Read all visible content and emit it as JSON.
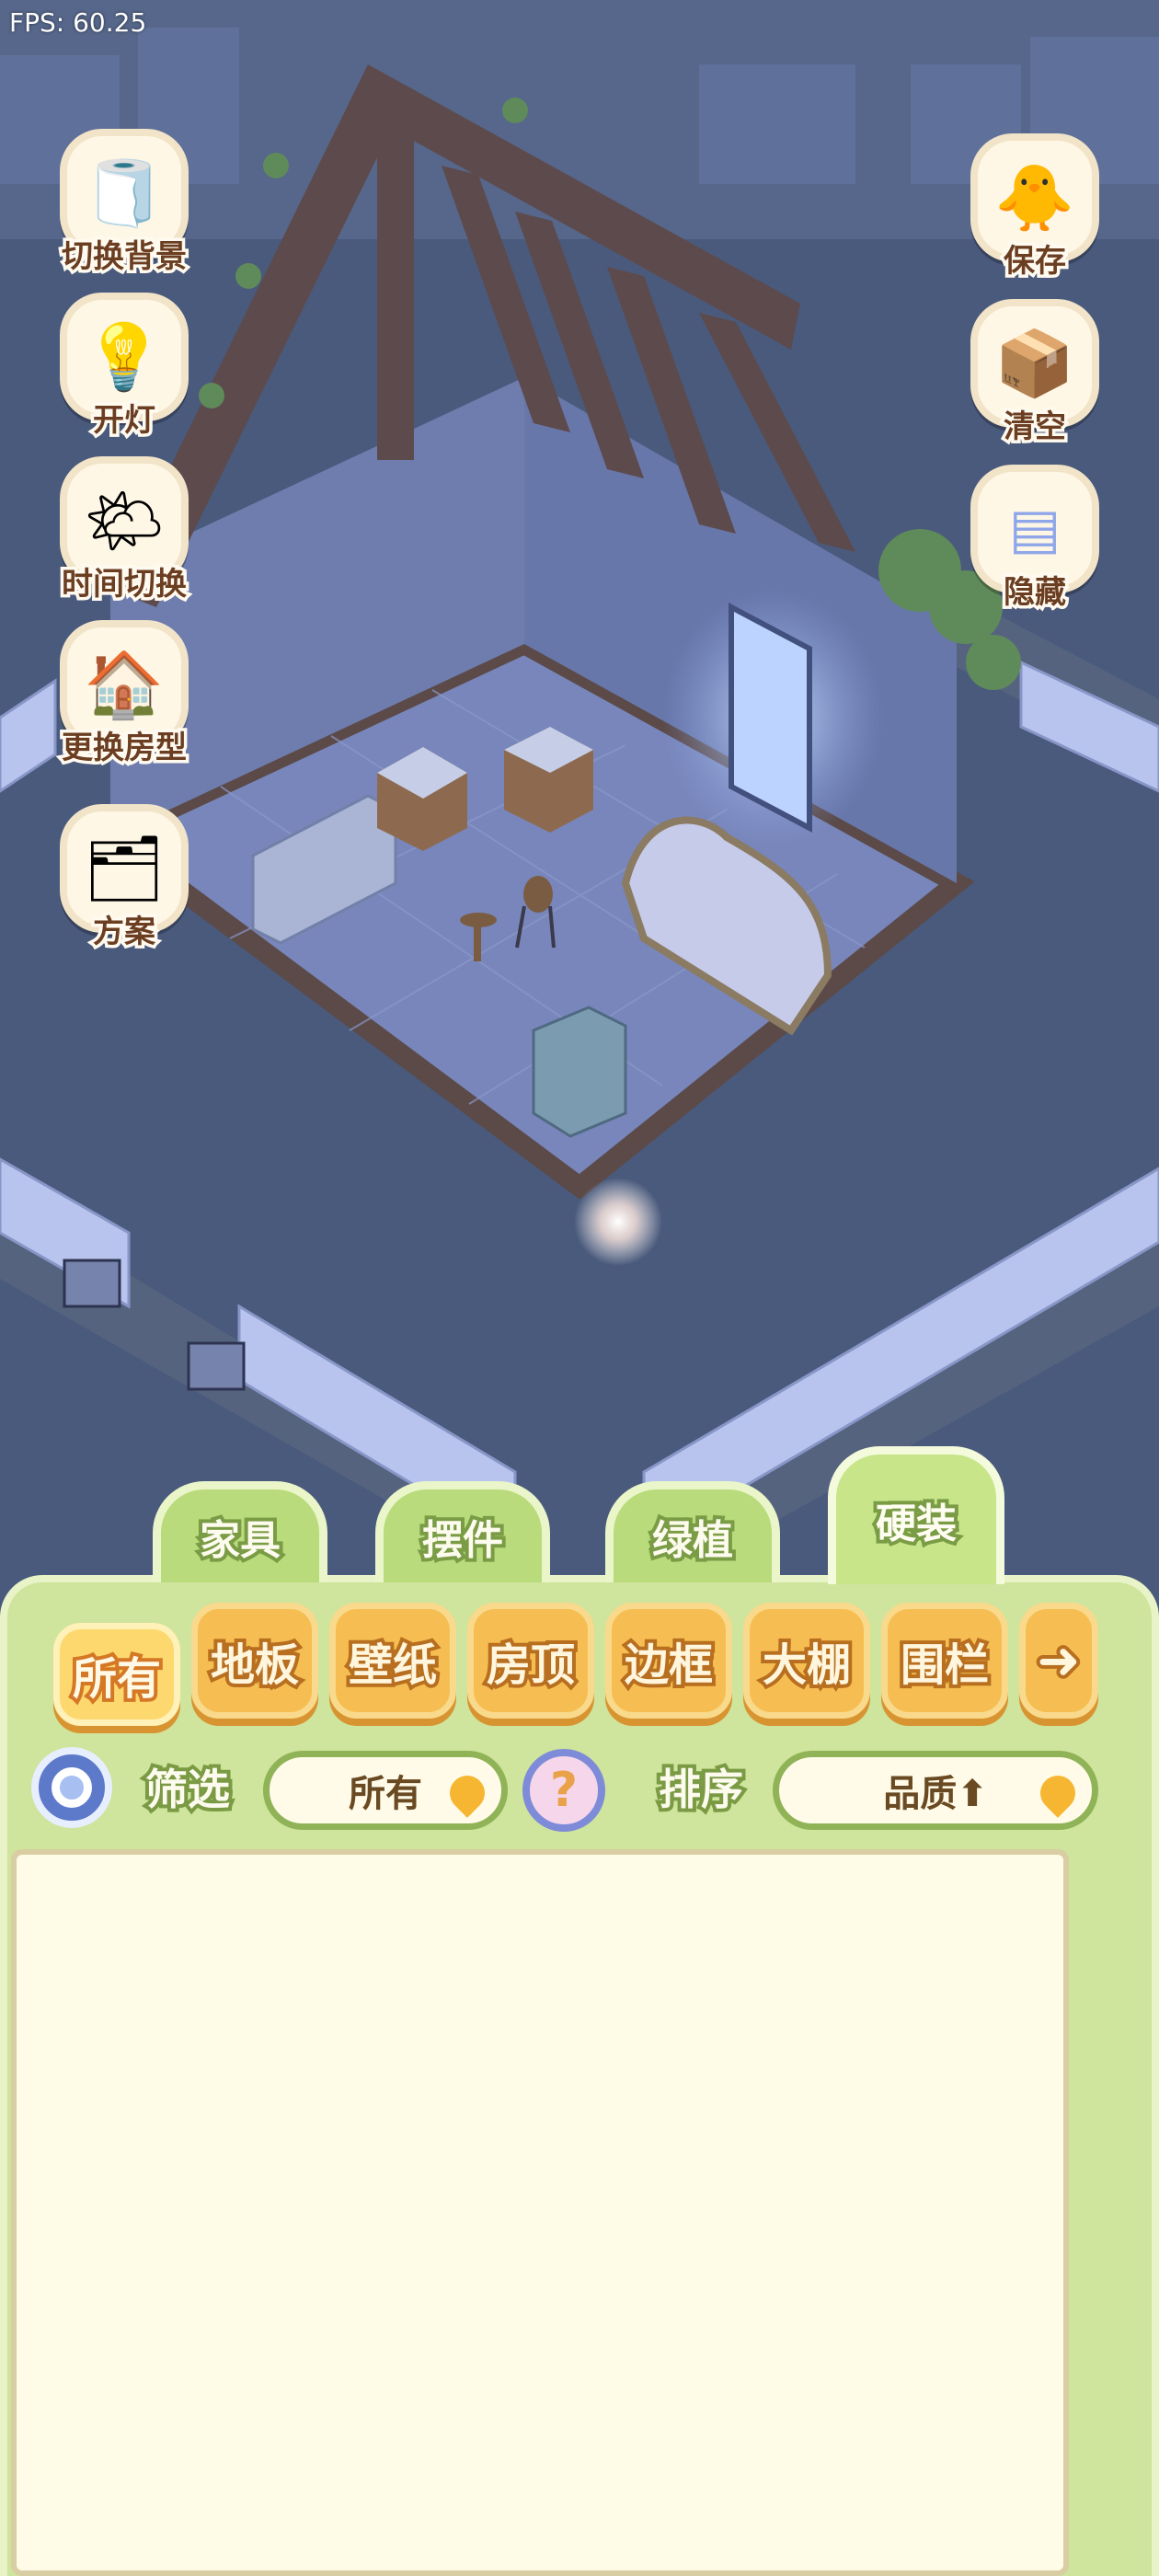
{
  "hud": {
    "fps": "FPS: 60.25"
  },
  "left_buttons": [
    {
      "label": "切换背景",
      "icon": "wallpaper-roll-icon"
    },
    {
      "label": "开灯",
      "icon": "lamp-icon"
    },
    {
      "label": "时间切换",
      "icon": "sun-moon-icon"
    },
    {
      "label": "更换房型",
      "icon": "house-icon"
    },
    {
      "label": "方案",
      "icon": "plan-fence-icon"
    }
  ],
  "right_buttons": [
    {
      "label": "保存",
      "icon": "duck-save-icon"
    },
    {
      "label": "清空",
      "icon": "box-clear-icon"
    },
    {
      "label": "隐藏",
      "icon": "hide-frame-icon"
    }
  ],
  "category_tabs": [
    {
      "label": "家具",
      "active": false
    },
    {
      "label": "摆件",
      "active": false
    },
    {
      "label": "绿植",
      "active": false
    },
    {
      "label": "硬装",
      "active": true
    }
  ],
  "sub_tabs": [
    {
      "label": "所有",
      "active": true
    },
    {
      "label": "地板"
    },
    {
      "label": "壁纸"
    },
    {
      "label": "房顶"
    },
    {
      "label": "边框"
    },
    {
      "label": "大棚"
    },
    {
      "label": "围栏"
    }
  ],
  "sub_tab_next": "➜",
  "filter": {
    "label": "筛选",
    "value": "所有"
  },
  "sort": {
    "label": "排序",
    "value": "品质⬆"
  },
  "help_symbol": "?",
  "colors": {
    "panel_green": "#cfe49c",
    "tab_orange": "#f6be52",
    "night_bg": "#48597a"
  }
}
